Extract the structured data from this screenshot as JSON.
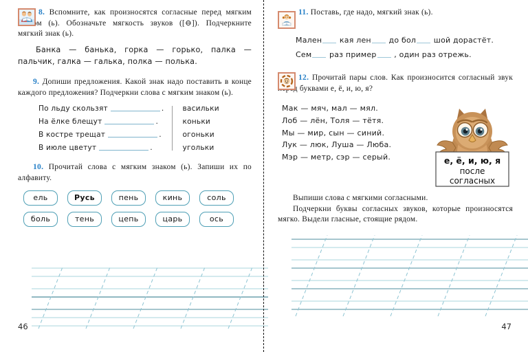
{
  "document": {
    "type": "russian-language-workbook-spread",
    "left_page_number": "46",
    "right_page_number": "47"
  },
  "left_page": {
    "exercises": [
      {
        "number": "8.",
        "icon": "two-children-reading-icon",
        "prompt": "Вспомните, как произносятся согласные перед мягким знаком (ь). Обозначьте мягкость звуков ([⊖]). Подчеркните мягкий знак (ь).",
        "examples": "Банка — банька, горка — горько, палка — пальчик, галка — галька, полка — полька."
      },
      {
        "number": "9.",
        "prompt": "Допиши предложения. Какой знак надо поставить в конце каждого предложения? Подчеркни слова с мягким знаком (ь).",
        "sentences": [
          {
            "text": "По льду скользят",
            "answer": "васильки"
          },
          {
            "text": "На ёлке блещут",
            "answer": "коньки"
          },
          {
            "text": "В костре трещат",
            "answer": "огоньки"
          },
          {
            "text": "В июле цветут",
            "answer": "угольки"
          }
        ]
      },
      {
        "number": "10.",
        "prompt": "Прочитай слова с мягким знаком (ь). Запиши их по алфавиту.",
        "chip_rows": [
          [
            {
              "word": "ель",
              "bold": false
            },
            {
              "word": "Русь",
              "bold": true
            },
            {
              "word": "пень",
              "bold": false
            },
            {
              "word": "кинь",
              "bold": false
            },
            {
              "word": "соль",
              "bold": false
            }
          ],
          [
            {
              "word": "боль",
              "bold": false
            },
            {
              "word": "тень",
              "bold": false
            },
            {
              "word": "цепь",
              "bold": false
            },
            {
              "word": "царь",
              "bold": false
            },
            {
              "word": "ось",
              "bold": false
            }
          ]
        ]
      }
    ]
  },
  "right_page": {
    "exercises": [
      {
        "number": "11.",
        "icon": "girl-reading-icon",
        "prompt": "Поставь, где надо, мягкий знак (ь).",
        "fill_lines": [
          {
            "parts": [
              "Мален",
              " кая лен",
              " до бол",
              " шой дорастёт."
            ]
          },
          {
            "parts": [
              "Сем",
              " раз пример",
              " , один раз отрежь."
            ]
          }
        ]
      },
      {
        "number": "12.",
        "icon": "sound-circle-face-icon",
        "prompt": "Прочитай пары слов. Как произносится согласный звук перед буквами е, ё, и, ю, я?",
        "pairs": [
          "Мак — мяч, мал — мял.",
          "Лоб — лён, Толя — тётя.",
          "Мы — мир, сын — синий.",
          "Лук — люк, Луша — Люба.",
          "Мэр — метр, сэр — серый."
        ],
        "owl_sign": {
          "line1": "е, ё, и, ю, я",
          "line2": "после",
          "line3": "согласных"
        },
        "tail_lines": [
          "Выпиши слова с мягкими согласными.",
          "Подчеркни буквы согласных звуков, которые произносятся мягко. Выдели гласные, стоящие рядом."
        ]
      }
    ]
  },
  "colors": {
    "exercise_number": "#2a82c8",
    "chip_border": "#4e9fb5",
    "rule_line_dark": "#4e8e9e",
    "rule_line_light": "#a8d4de",
    "slant_guide": "#8cc3d2",
    "badge_border": "#d58a6e"
  }
}
